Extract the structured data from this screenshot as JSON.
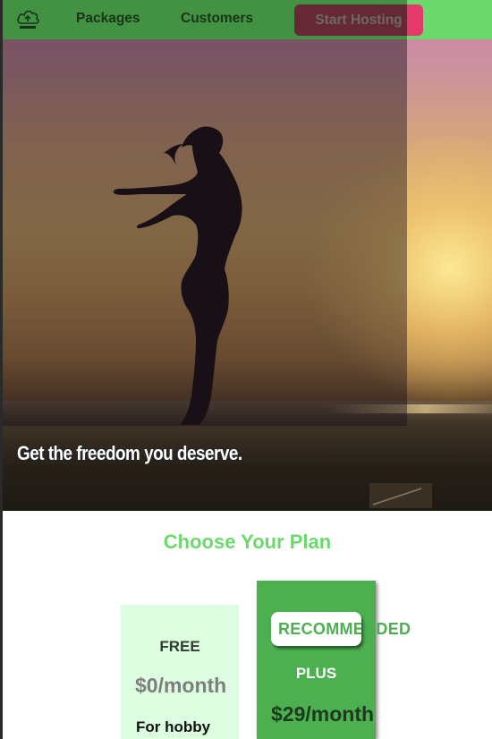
{
  "nav": {
    "logo_icon": "cloud-logo-icon",
    "links": [
      "Packages",
      "Customers"
    ],
    "cta_label": "Start Hosting"
  },
  "hero": {
    "heading": "Get the freedom you deserve.",
    "image": "woman-silhouette-at-sunset-beach"
  },
  "plans": {
    "title": "Choose Your Plan",
    "cards": [
      {
        "name": "FREE",
        "price": "$0/month",
        "description": "For hobby"
      },
      {
        "badge": "RECOMMENDED",
        "name": "PLUS",
        "price": "$29/month"
      }
    ]
  },
  "colors": {
    "brand_green": "#6bd96c",
    "card_green": "#4caf50",
    "card_light": "#dcfde0",
    "cta_pink": "#e33a6b"
  }
}
